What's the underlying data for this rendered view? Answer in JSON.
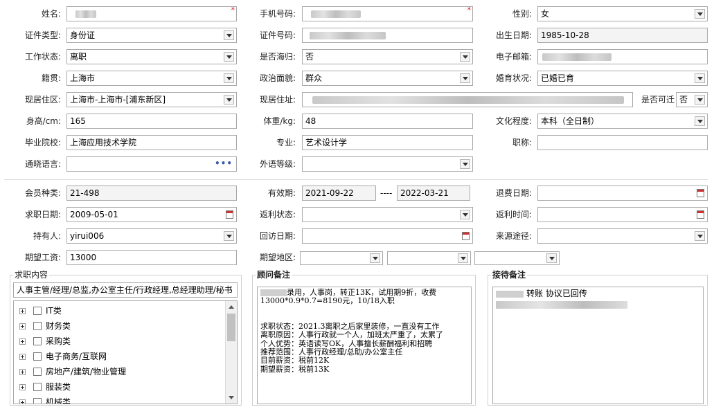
{
  "personal": {
    "name_label": "姓名:",
    "phone_label": "手机号码:",
    "gender_label": "性别:",
    "gender_value": "女",
    "id_type_label": "证件类型:",
    "id_type_value": "身份证",
    "id_no_label": "证件号码:",
    "birth_label": "出生日期:",
    "birth_value": "1985-10-28",
    "work_status_label": "工作状态:",
    "work_status_value": "离职",
    "overseas_label": "是否海归:",
    "overseas_value": "否",
    "email_label": "电子邮箱:",
    "native_label": "籍贯:",
    "native_value": "上海市",
    "political_label": "政治面貌:",
    "political_value": "群众",
    "marital_label": "婚育状况:",
    "marital_value": "已婚已育",
    "district_label": "现居住区:",
    "district_value": "上海市-上海市-[浦东新区]",
    "address_label": "现居住址:",
    "relocate_label": "是否可迁",
    "relocate_value": "否",
    "height_label": "身高/cm:",
    "height_value": "165",
    "weight_label": "体重/kg:",
    "weight_value": "48",
    "education_label": "文化程度:",
    "education_value": "本科（全日制）",
    "school_label": "毕业院校:",
    "school_value": "上海应用技术学院",
    "major_label": "专业:",
    "major_value": "艺术设计学",
    "title_label": "职称:",
    "language_label": "通晓语言:",
    "foreign_level_label": "外语等级:",
    "required_mark": "*",
    "more_dots": "•••"
  },
  "membership": {
    "member_type_label": "会员种类:",
    "member_type_value": "21-498",
    "valid_label": "有效期:",
    "valid_from": "2021-09-22",
    "valid_sep": "----",
    "valid_to": "2022-03-21",
    "refund_date_label": "退费日期:",
    "job_date_label": "求职日期:",
    "job_date_value": "2009-05-01",
    "rebate_status_label": "返利状态:",
    "rebate_time_label": "返利时间:",
    "holder_label": "持有人:",
    "holder_value": "yirui006",
    "visit_date_label": "回访日期:",
    "source_label": "来源途径:",
    "salary_label": "期望工资:",
    "salary_value": "13000",
    "region_label": "期望地区:"
  },
  "job_content": {
    "title": "求职内容",
    "input_value": "人事主管/经理/总监,办公室主任/行政经理,总经理助理/秘书",
    "tree": [
      {
        "label": "IT类"
      },
      {
        "label": "财务类"
      },
      {
        "label": "采购类"
      },
      {
        "label": "电子商务/互联网"
      },
      {
        "label": "房地产/建筑/物业管理"
      },
      {
        "label": "服装类"
      },
      {
        "label": "机械类"
      }
    ]
  },
  "consultant_note": {
    "title": "顾问备注",
    "line1": "录用，人事岗，转正13K，试用期9折，收费",
    "line2": "13000*0.9*0.7=8190元，10/18入职",
    "rest": "求职状态：2021.3离职之后家里装修，一直没有工作\n离职原因：人事行政就一个人，加班太严重了，太累了\n个人优势：英语读写OK，人事擅长薪酬福利和招聘\n推荐范围：人事行政经理/总助/办公室主任\n目前薪资：税前12K\n期望薪资：税前13K"
  },
  "reception_note": {
    "title": "接待备注",
    "line1": "转账 协议已回传"
  },
  "colors": {
    "required": "#ee0000",
    "border": "#a9a9a9",
    "readonly_bg": "#f4f4f4"
  }
}
